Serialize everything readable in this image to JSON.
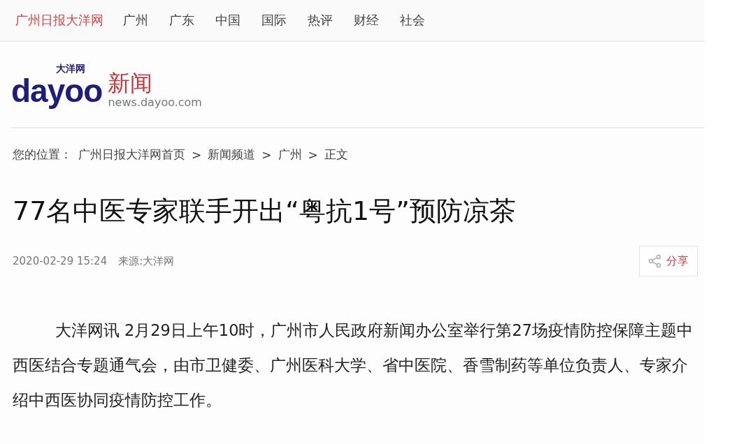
{
  "nav": [
    {
      "label": "广州日报大洋网",
      "selected": true
    },
    {
      "label": "广州",
      "selected": false
    },
    {
      "label": "广东",
      "selected": false
    },
    {
      "label": "中国",
      "selected": false
    },
    {
      "label": "国际",
      "selected": false
    },
    {
      "label": "热评",
      "selected": false
    },
    {
      "label": "财经",
      "selected": false
    },
    {
      "label": "社会",
      "selected": false
    }
  ],
  "logo": {
    "small": "大洋网",
    "brand": "dayoo",
    "section": "新闻",
    "domain": "news.dayoo.com"
  },
  "breadcrumb": {
    "label": "您的位置：",
    "items": [
      "广州日报大洋网首页",
      "新闻频道",
      "广州",
      "正文"
    ],
    "separator": ">"
  },
  "article": {
    "title": "77名中医专家联手开出“粤抗1号”预防凉茶",
    "date": "2020-02-29 15:24",
    "source": "来源:大洋网",
    "share": "分享",
    "paragraph": "大洋网讯 2月29日上午10时，广州市人民政府新闻办公室举行第27场疫情防控保障主题中西医结合专题通气会，由市卫健委、广州医科大学、省中医院、香雪制药等单位负责人、专家介绍中西医协同疫情防控工作。"
  }
}
